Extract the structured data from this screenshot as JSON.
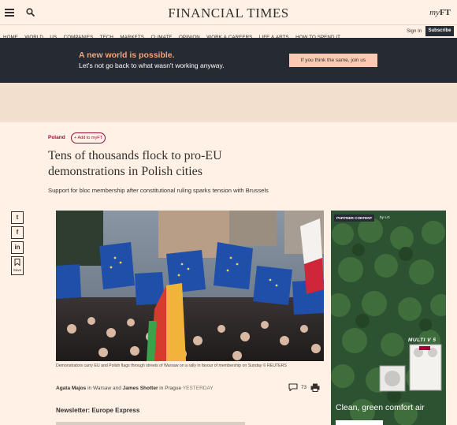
{
  "header": {
    "logo": "FINANCIAL TIMES",
    "myft_prefix": "my",
    "myft_suffix": "FT"
  },
  "nav": {
    "items": [
      "HOME",
      "WORLD",
      "US",
      "COMPANIES",
      "TECH",
      "MARKETS",
      "CLIMATE",
      "OPINION",
      "WORK & CAREERS",
      "LIFE & ARTS",
      "HOW TO SPEND IT"
    ],
    "sign_in": "Sign In",
    "subscribe": "Subscribe"
  },
  "banner": {
    "headline": "A new world is possible.",
    "subline": "Let's not go back to what wasn't working anyway.",
    "cta": "If you think the same, join us"
  },
  "article": {
    "section": "Poland",
    "add_to_myft": "+ Add to myFT",
    "headline": "Tens of thousands flock to pro-EU demonstrations in Polish cities",
    "standfirst": "Support for bloc membership after constitutional ruling sparks tension with Brussels",
    "caption": "Demonstrators carry EU and Polish flags through streets of Warsaw on a rally in favour of membership on Sunday © REUTERS",
    "author1": "Agata Majos",
    "in1": " in Warsaw and ",
    "author2": "James Shotter",
    "in2": " in Prague ",
    "timestamp": "YESTERDAY",
    "comment_count": "73",
    "newsletter_title": "Newsletter: Europe Express"
  },
  "share": {
    "twitter": "t",
    "facebook": "f",
    "linkedin": "in",
    "save": "Save"
  },
  "ad": {
    "tag": "PARTNER CONTENT",
    "by": "by LG",
    "brand": "MULTI V 5",
    "copy": "Clean, green comfort air"
  },
  "colors": {
    "page_bg": "#fff1e5",
    "banner_bg": "#262a33",
    "banner_accent": "#f2a57b",
    "claret": "#990f3d"
  }
}
